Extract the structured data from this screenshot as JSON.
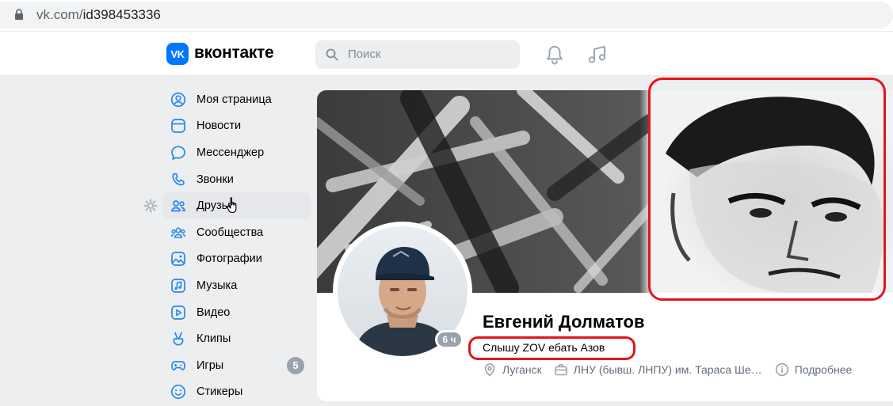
{
  "browser": {
    "url_host": "vk.com/",
    "url_path": "id398453336"
  },
  "header": {
    "logo_mark": "VK",
    "logo_text": "вконтакте",
    "search_placeholder": "Поиск",
    "icons": [
      "bell-icon",
      "music-icon"
    ]
  },
  "sidebar": {
    "items": [
      {
        "label": "Моя страница",
        "icon": "user-circle-icon"
      },
      {
        "label": "Новости",
        "icon": "news-icon"
      },
      {
        "label": "Мессенджер",
        "icon": "message-icon"
      },
      {
        "label": "Звонки",
        "icon": "phone-icon"
      },
      {
        "label": "Друзья",
        "icon": "friends-icon"
      },
      {
        "label": "Сообщества",
        "icon": "communities-icon"
      },
      {
        "label": "Фотографии",
        "icon": "photo-icon"
      },
      {
        "label": "Музыка",
        "icon": "music-note-icon"
      },
      {
        "label": "Видео",
        "icon": "video-icon"
      },
      {
        "label": "Клипы",
        "icon": "clips-icon"
      },
      {
        "label": "Игры",
        "icon": "gamepad-icon",
        "badge": "5"
      },
      {
        "label": "Стикеры",
        "icon": "smile-icon"
      }
    ]
  },
  "profile": {
    "name": "Евгений Долматов",
    "status": "Слышу ZOV ебать Азов",
    "last_seen": "6 ч",
    "city": "Луганск",
    "education": "ЛНУ (бывш. ЛНПУ) им. Тараса Ше…",
    "more": "Подробнее"
  },
  "colors": {
    "accent": "#0077ff",
    "annotation": "#e3141c",
    "muted": "#626d7a"
  }
}
